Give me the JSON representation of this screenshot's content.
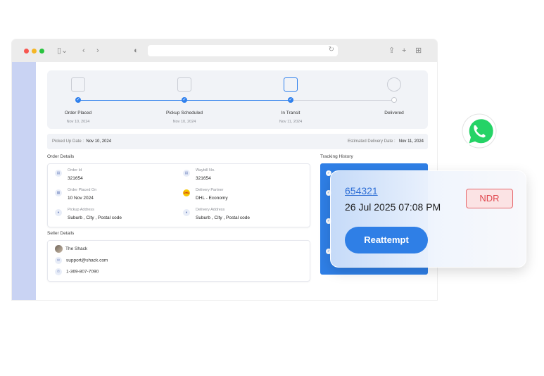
{
  "stepper": {
    "steps": [
      {
        "label": "Order Placed",
        "date": "Nov 10, 2024",
        "icon": "box-icon"
      },
      {
        "label": "Pickup Scheduled",
        "date": "Nov 10, 2024",
        "icon": "document-icon"
      },
      {
        "label": "In Transit",
        "date": "Nov 11, 2024",
        "icon": "truck-icon"
      },
      {
        "label": "Delivered",
        "date": "",
        "icon": "check-circle-icon"
      }
    ]
  },
  "dates_bar": {
    "picked_label": "Picked Up Date :",
    "picked_value": "Nov 10, 2024",
    "eta_label": "Estimated Delivery Date :",
    "eta_value": "Nov 11, 2024"
  },
  "order_details": {
    "title": "Order Details",
    "order_id_label": "Order Id",
    "order_id": "321654",
    "waybill_label": "Waybill No.",
    "waybill": "321654",
    "placed_on_label": "Order Placed On",
    "placed_on": "10 Nov 2024",
    "partner_label": "Delivery Partner",
    "partner": "DHL - Economy",
    "pickup_label": "Pickup Address",
    "pickup": "Suburb , City , Postal code",
    "delivery_label": "Delivery Address",
    "delivery": "Suburb , City , Postal code",
    "partner_logo_text": "DHL"
  },
  "seller": {
    "title": "Seller Details",
    "name": "The Shack",
    "email": "support@shack.com",
    "phone": "1-369-807-7090"
  },
  "tracking": {
    "title": "Tracking History"
  },
  "ndr_card": {
    "order_number": "654321",
    "datetime": "26 Jul 2025 07:08 PM",
    "badge": "NDR",
    "button": "Reattempt"
  },
  "colors": {
    "accent": "#2f7fe6",
    "sidebar": "#c9d3f3",
    "ndr_red": "#e0474e",
    "whatsapp": "#25d366"
  }
}
